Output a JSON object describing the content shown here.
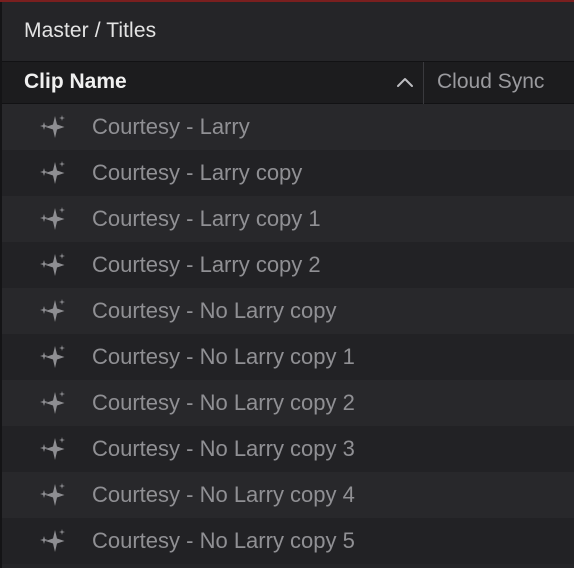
{
  "breadcrumb": "Master / Titles",
  "columns": {
    "clip_name": "Clip Name",
    "cloud_sync": "Cloud Sync"
  },
  "sort": {
    "column": "Clip Name",
    "direction": "ascending",
    "icon": "chevron-up-icon"
  },
  "row_icon": "title-sparkle-icon",
  "colors": {
    "top_accent": "#7a1f1f",
    "text_primary": "#e4e4e4",
    "text_muted": "#909094"
  },
  "clips": [
    {
      "name": "Courtesy - Larry"
    },
    {
      "name": "Courtesy - Larry copy"
    },
    {
      "name": "Courtesy - Larry copy 1"
    },
    {
      "name": "Courtesy - Larry copy 2"
    },
    {
      "name": "Courtesy - No Larry copy"
    },
    {
      "name": "Courtesy - No Larry copy 1"
    },
    {
      "name": "Courtesy - No Larry copy 2"
    },
    {
      "name": "Courtesy - No Larry copy 3"
    },
    {
      "name": "Courtesy - No Larry copy 4"
    },
    {
      "name": "Courtesy - No Larry copy 5"
    }
  ]
}
